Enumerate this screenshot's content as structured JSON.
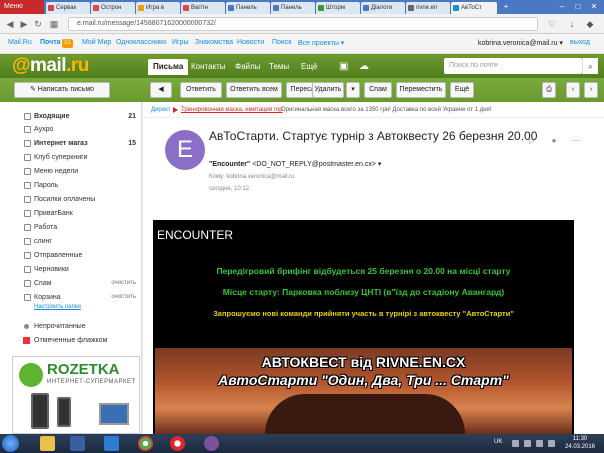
{
  "browser": {
    "menu_label": "Меню",
    "tabs": [
      {
        "label": "Сервак",
        "active": false
      },
      {
        "label": "Острон",
        "active": false
      },
      {
        "label": "Игра в",
        "active": false
      },
      {
        "label": "Вагітн",
        "active": false
      },
      {
        "label": "Панель",
        "active": false
      },
      {
        "label": "Панель",
        "active": false
      },
      {
        "label": "Шторм",
        "active": false
      },
      {
        "label": "Діалоги",
        "active": false
      },
      {
        "label": "rivne.en",
        "active": false
      },
      {
        "label": "АвТоСт",
        "active": true
      }
    ],
    "url": "e.mail.ru/message/14588071620000000732/"
  },
  "portal": {
    "links": [
      "Mail.Ru",
      "Почта",
      "Мой Мир",
      "Одноклассники",
      "Игры",
      "Знакомства",
      "Новости",
      "Поиск",
      "Все проекты ▾"
    ],
    "inbox_count": "21",
    "user_email": "kobrina.veronica@mail.ru ▾",
    "logout": "выход"
  },
  "header": {
    "logo_at": "@",
    "logo_text": "mail",
    "logo_suffix": ".ru",
    "tabs": [
      "Письма",
      "Контакты",
      "Файлы",
      "Темы",
      "Ещё"
    ],
    "search_placeholder": "Поиск по почте"
  },
  "toolbar": {
    "compose": "Написать письмо",
    "reply": "Ответить",
    "reply_all": "Ответить всем",
    "forward": "Переслать",
    "delete": "Удалить",
    "spam": "Спам",
    "move": "Переместить",
    "more": "Ещё"
  },
  "sidebar": {
    "folders": [
      {
        "label": "Входящие",
        "count": "21",
        "bold": true
      },
      {
        "label": "Аухро",
        "count": "",
        "bold": false
      },
      {
        "label": "Интернет магаз",
        "count": "15",
        "bold": true
      },
      {
        "label": "Клуб суперкниги",
        "count": "",
        "bold": false
      },
      {
        "label": "Меню недели",
        "count": "",
        "bold": false
      },
      {
        "label": "Пароль",
        "count": "",
        "bold": false
      },
      {
        "label": "Посилки оплачены",
        "count": "",
        "bold": false
      },
      {
        "label": "ПриватБанк",
        "count": "",
        "bold": false
      },
      {
        "label": "Работа",
        "count": "",
        "bold": false
      },
      {
        "label": "слинг",
        "count": "",
        "bold": false
      },
      {
        "label": "Отправленные",
        "count": "",
        "bold": false
      },
      {
        "label": "Черновики",
        "count": "",
        "bold": false
      },
      {
        "label": "Спам",
        "count": "",
        "bold": false,
        "clear": "очистить"
      },
      {
        "label": "Корзина",
        "count": "",
        "bold": false,
        "clear": "очистить"
      }
    ],
    "folder_settings": "Настроить папки",
    "filters": [
      "Непрочитанные",
      "Отмеченные флажком"
    ],
    "ad": {
      "brand": "ROZETKA",
      "tagline": "ИНТЕРНЕТ-СУПЕРМАРКЕТ"
    }
  },
  "message": {
    "ad_label": "Директ",
    "ad_link": "Тренировочная маска, имитация гор",
    "ad_text": "Оригинальная маска всего за 1350 грн! Доставка по всей Украине от 1 дня!",
    "avatar_letter": "E",
    "subject": "АвТоСтарти. Стартує турнір з Автоквесту 26 березня 20.00",
    "sender_name": "\"Encounter\"",
    "sender_email": "<DO_NOT_REPLY@postmaster.en.cx>",
    "to_label": "Кому:",
    "to_value": "kobrina.veronica@mail.ru",
    "date": "сегодня, 10:12"
  },
  "email": {
    "title": "ENCOUNTER",
    "line1": "Передігровий брифінг відбудеться 25 березня о 20.00 на місці старту",
    "line2": "Місце старту: Парковка поблизу ЦНТІ (в\"їзд до стадіону Авангард)",
    "line3": "Запрошуємо нові команди прийняти участь в турнірі з автоквесту \"АвтоСтарти\"",
    "banner_line1": "АВТОКВЕСТ від RIVNE.EN.CX",
    "banner_line2": "АвтоСтарти \"Один, Два, Три ... Старт\""
  },
  "taskbar": {
    "lang": "UK",
    "time": "11:30",
    "date": "24.03.2016"
  },
  "colors": {
    "mail_green": "#6f9b2f",
    "link_blue": "#168de2",
    "enc_green": "#35c435",
    "enc_yellow": "#e6d200"
  }
}
